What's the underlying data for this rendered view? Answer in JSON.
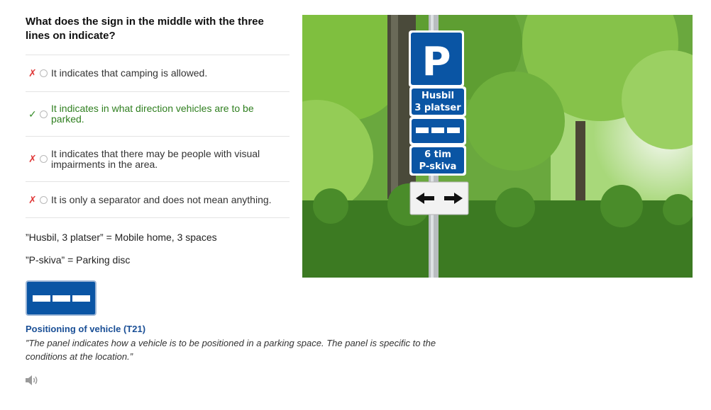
{
  "question": {
    "text": "What does the sign in the middle with the three lines on indicate?"
  },
  "answers": [
    {
      "status": "wrong",
      "mark": "✗",
      "text": "It indicates that camping is allowed."
    },
    {
      "status": "right",
      "mark": "✓",
      "text": "It indicates in what direction vehicles are to be parked."
    },
    {
      "status": "wrong",
      "mark": "✗",
      "text": "It indicates that there may be people with visual impairments in the area."
    },
    {
      "status": "wrong",
      "mark": "✗",
      "text": "It is only a separator and does not mean anything."
    }
  ],
  "notes": [
    "”Husbil, 3 platser” = Mobile home, 3 spaces",
    "”P-skiva” = Parking disc"
  ],
  "sign": {
    "title": "Positioning of vehicle (T21)",
    "description": "”The panel indicates how a vehicle is to be positioned in a parking space. The panel is specific to the conditions at the location.”"
  },
  "photo_signs": {
    "p": "P",
    "husbil_line1": "Husbil",
    "husbil_line2": "3 platser",
    "tim_line1": "6 tim",
    "tim_line2": "P-skiva"
  },
  "icons": {
    "speaker": "speaker-icon",
    "wrong": "cross-icon",
    "right": "check-icon"
  },
  "colors": {
    "sign_blue": "#0a55a4",
    "correct_green": "#2f7f1f",
    "wrong_red": "#e03a3a",
    "title_blue": "#1a4f96"
  }
}
